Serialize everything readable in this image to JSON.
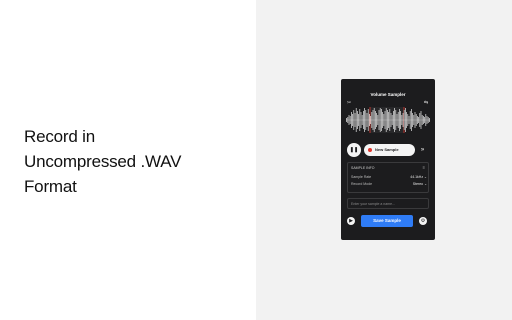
{
  "headline": {
    "line1": "Record in",
    "line2": "Uncompressed .WAV",
    "line3": "Format"
  },
  "app": {
    "title": "Volume Sampler",
    "new_sample_label": "New Sample",
    "settings": {
      "header": "SAMPLE INFO",
      "rows": [
        {
          "key": "Sample Rate",
          "value": "44.1kHz ⌄"
        },
        {
          "key": "Record Mode",
          "value": "Stereo ⌄"
        }
      ]
    },
    "name_placeholder": "Enter your sample a name...",
    "save_label": "Save Sample"
  },
  "colors": {
    "phone_bg": "#1c1c1e",
    "accent_blue": "#2f7cf6",
    "record_red": "#e0362c",
    "selection_red": "#e0362c",
    "waveform": "#e8e8e8"
  },
  "icons": {
    "top_left": "scissors-icon",
    "top_right": "swap-icon",
    "pause": "pause-icon",
    "skip": "fast-forward-icon",
    "settings": "sliders-icon",
    "bottom_left": "play-icon",
    "bottom_right": "settings-icon"
  }
}
